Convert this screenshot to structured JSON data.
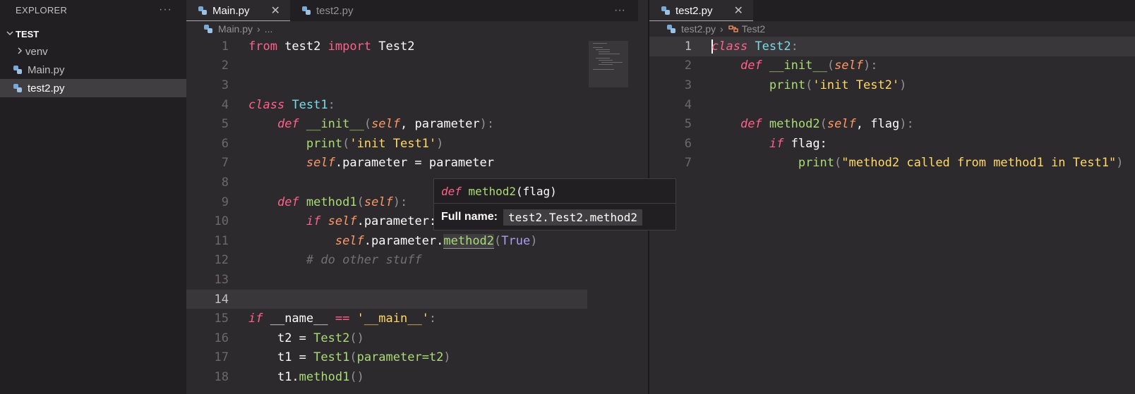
{
  "explorer": {
    "title": "EXPLORER",
    "more": "···",
    "folder": "TEST",
    "items": [
      {
        "label": "venv"
      },
      {
        "label": "Main.py"
      },
      {
        "label": "test2.py"
      }
    ]
  },
  "left_editor": {
    "tabs": [
      {
        "label": "Main.py",
        "close": "✕"
      },
      {
        "label": "test2.py"
      }
    ],
    "more": "···",
    "breadcrumb": {
      "file": "Main.py",
      "rest": "..."
    },
    "line_numbers": [
      "1",
      "2",
      "3",
      "4",
      "5",
      "6",
      "7",
      "8",
      "9",
      "10",
      "11",
      "12",
      "13",
      "14",
      "15",
      "16",
      "17",
      "18"
    ]
  },
  "right_editor": {
    "tabs": [
      {
        "label": "test2.py",
        "close": "✕"
      }
    ],
    "breadcrumb": {
      "file": "test2.py",
      "symbol": "Test2"
    },
    "line_numbers": [
      "1",
      "2",
      "3",
      "4",
      "5",
      "6",
      "7"
    ]
  },
  "hover": {
    "sig_kw": "def",
    "sig_name": "method2",
    "sig_params": "(flag)",
    "full_label": "Full name:",
    "full_value": "test2.Test2.method2"
  },
  "code": {
    "main": {
      "l1_from": "from",
      "l1_mod": " test2 ",
      "l1_import": "import",
      "l1_name": " Test2",
      "l4_class": "class",
      "l4_name": "Test1",
      "l4_colon": ":",
      "l5_def": "def",
      "l5_name": "__init__",
      "l5_open": "(",
      "l5_self": "self",
      "l5_rest": ", parameter",
      "l5_close": ")",
      "l5_colon": ":",
      "l6_print": "print",
      "l6_open": "(",
      "l6_str": "'init Test1'",
      "l6_close": ")",
      "l7_self": "self",
      "l7_rest": ".parameter = parameter",
      "l9_def": "def",
      "l9_name": "method1",
      "l9_open": "(",
      "l9_self": "self",
      "l9_close": ")",
      "l9_colon": ":",
      "l10_if": "if",
      "l10_self": "self",
      "l10_rest": ".parameter:",
      "l11_self": "self",
      "l11_rest": ".parameter.",
      "l11_call": "method2",
      "l11_open": "(",
      "l11_arg": "True",
      "l11_close": ")",
      "l12_cmt": "# do other stuff",
      "l15_if": "if",
      "l15_rest": " __name__ ",
      "l15_eq": "==",
      "l15_str": " '__main__'",
      "l15_colon": ":",
      "l16_var": "t2 = ",
      "l16_cls": "Test2",
      "l16_par": "()",
      "l17_var": "t1 = ",
      "l17_cls": "Test1",
      "l17_open": "(",
      "l17_arg": "parameter=t2",
      "l17_close": ")",
      "l18_var": "t1.",
      "l18_call": "method1",
      "l18_par": "()"
    },
    "test2": {
      "l1_class": "class",
      "l1_name": "Test2",
      "l1_colon": ":",
      "l2_def": "def",
      "l2_name": "__init__",
      "l2_open": "(",
      "l2_self": "self",
      "l2_close": ")",
      "l2_colon": ":",
      "l3_print": "print",
      "l3_open": "(",
      "l3_str": "'init Test2'",
      "l3_close": ")",
      "l5_def": "def",
      "l5_name": "method2",
      "l5_open": "(",
      "l5_self": "self",
      "l5_rest": ", flag",
      "l5_close": ")",
      "l5_colon": ":",
      "l6_if": "if",
      "l6_rest": " flag:",
      "l7_print": "print",
      "l7_open": "(",
      "l7_str": "\"method2 called from method1 in Test1\"",
      "l7_close": ")"
    }
  },
  "colors": {
    "background": "#2d2a2e",
    "keyword": "#ff6188",
    "function": "#a9dc76",
    "class": "#78dce8",
    "string": "#ffd866",
    "self": "#fc9867"
  }
}
